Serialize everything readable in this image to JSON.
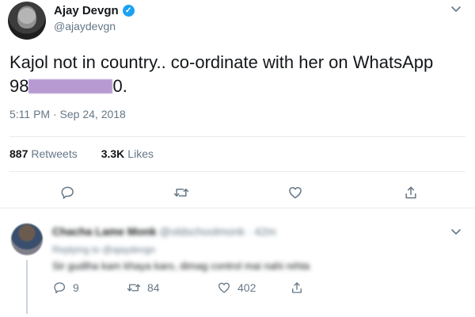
{
  "tweet": {
    "display_name": "Ajay Devgn",
    "verified_icon": "verified-badge-icon",
    "handle": "@ajaydevgn",
    "text_line1": "Kajol not in country.. co-ordinate with her on WhatsApp",
    "text_phone_prefix": "98",
    "text_phone_suffix": "0.",
    "timestamp": "5:11 PM · Sep 24, 2018",
    "retweets_count": "887",
    "retweets_label": "Retweets",
    "likes_count": "3.3K",
    "likes_label": "Likes",
    "icons": [
      "reply-icon",
      "retweet-icon",
      "like-icon",
      "share-icon",
      "chevron-down-icon"
    ]
  },
  "reply": {
    "name": "Chacha Lame Monk",
    "meta": "@oldschoolmonk · 42m",
    "replying_to": "Replying to @ajaydevgn",
    "text": "Sir gudiha kam khaya karo, dimag control mai nahi rehta",
    "reply_count": "9",
    "retweet_count": "84",
    "like_count": "402"
  },
  "colors": {
    "text_primary": "#14171a",
    "text_secondary": "#657786",
    "verified_blue": "#1da1f2",
    "redaction": "#b79ad2",
    "divider": "#e6ecf0"
  }
}
